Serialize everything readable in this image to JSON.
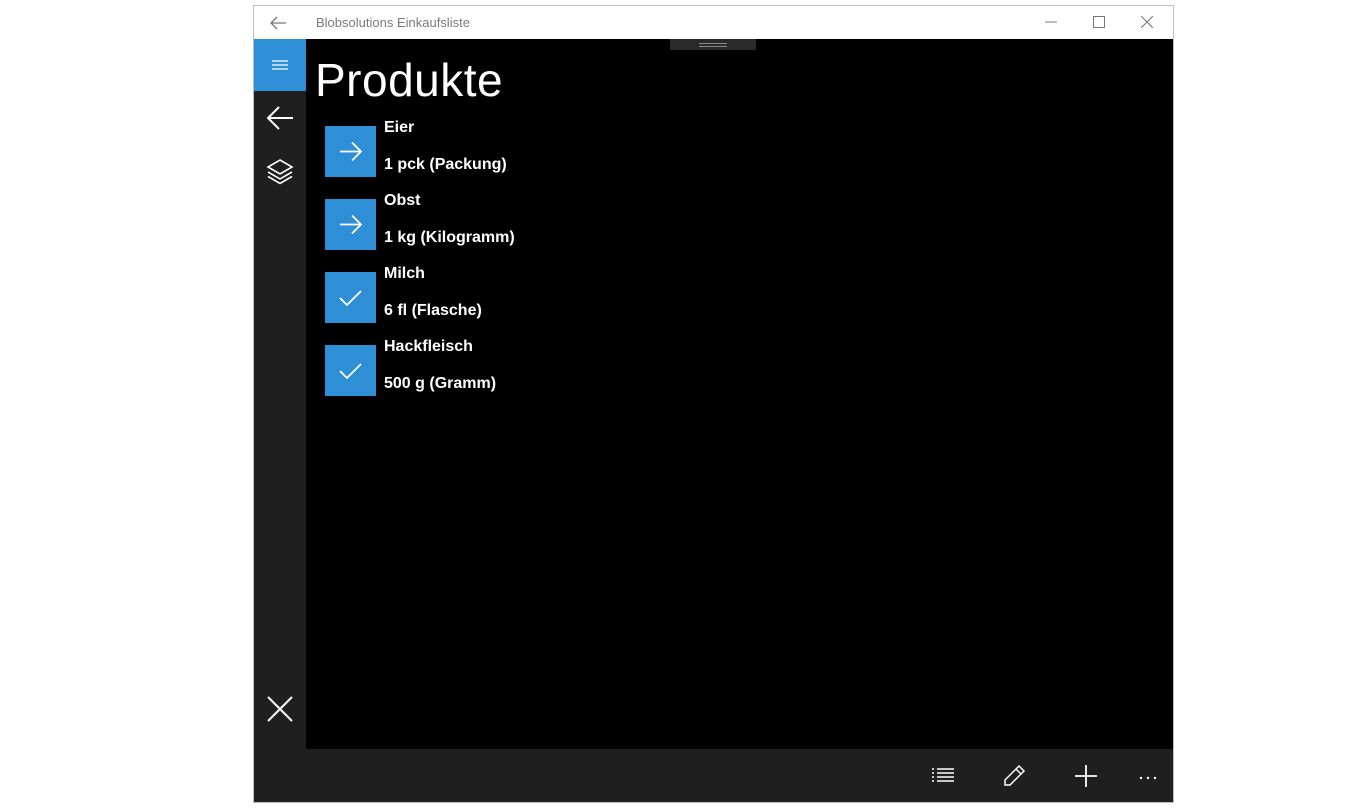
{
  "window": {
    "title": "Blobsolutions Einkaufsliste"
  },
  "page": {
    "title": "Produkte"
  },
  "products": [
    {
      "name": "Eier",
      "quantity": "1 pck (Packung)",
      "status_icon": "arrow-right-icon"
    },
    {
      "name": "Obst",
      "quantity": "1 kg (Kilogramm)",
      "status_icon": "arrow-right-icon"
    },
    {
      "name": "Milch",
      "quantity": "6 fl (Flasche)",
      "status_icon": "checkmark-icon"
    },
    {
      "name": "Hackfleisch",
      "quantity": "500 g (Gramm)",
      "status_icon": "checkmark-icon"
    }
  ],
  "appbar": {
    "more_label": "···"
  },
  "colors": {
    "accent": "#2e8fd6",
    "background": "#000000",
    "nav_background": "#1f1f1f"
  }
}
